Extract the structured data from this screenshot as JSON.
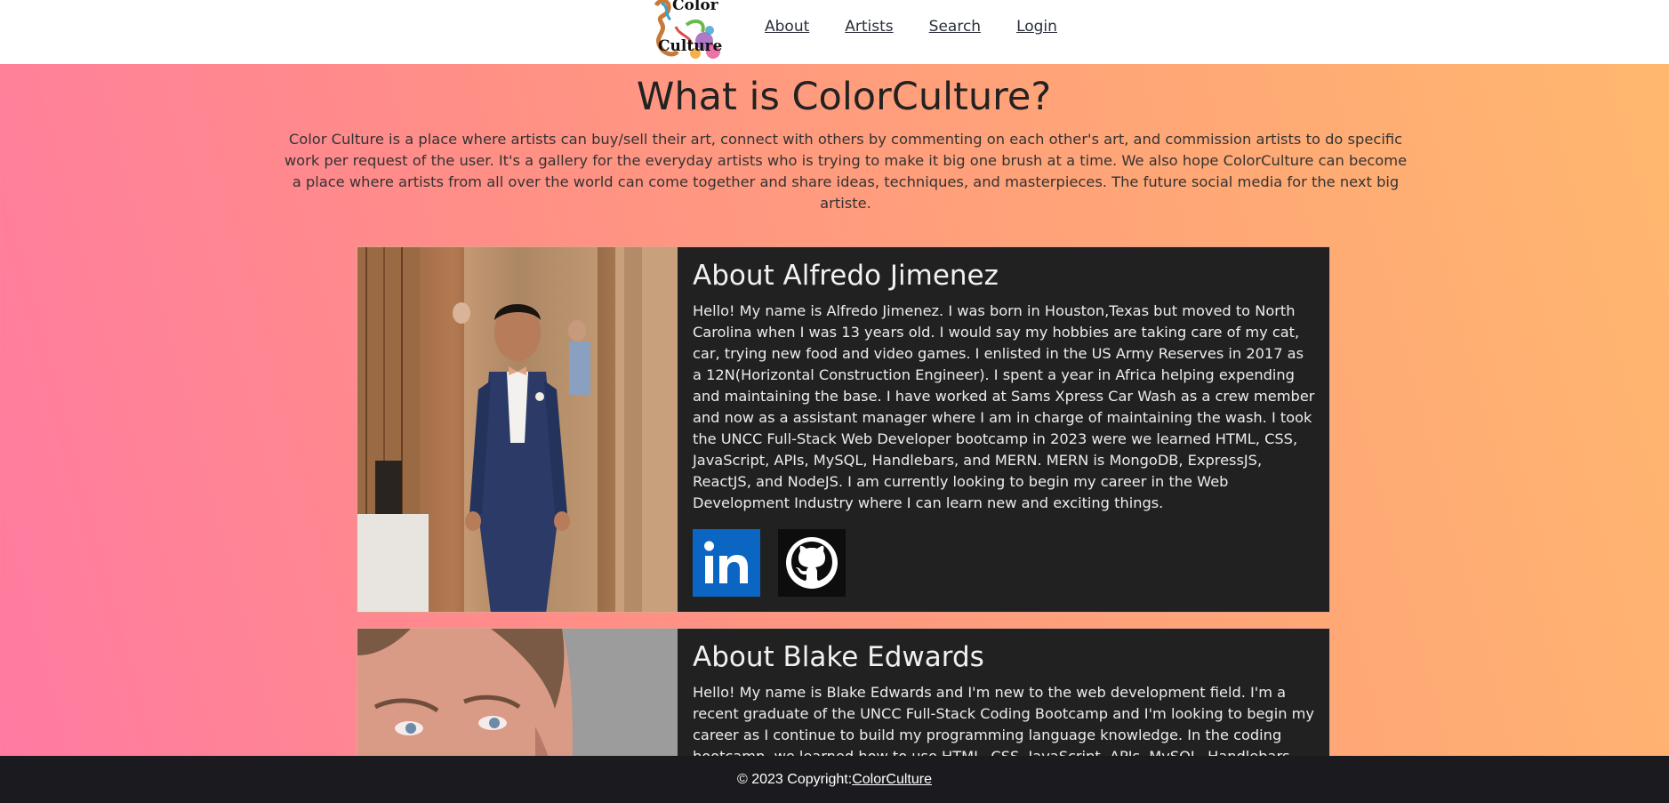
{
  "nav": {
    "logo_line1": "Color",
    "logo_line2": "Culture",
    "links": [
      "About",
      "Artists",
      "Search",
      "Login"
    ]
  },
  "hero": {
    "title": "What is ColorCulture?",
    "description": "Color Culture is a place where artists can buy/sell their art, connect with others by commenting on each other's art, and commission artists to do specific work per request of the user. It's a gallery for the everyday artists who is trying to make it big one brush at a time. We also hope ColorCulture can become a place where artists from all over the world can come together and share ideas, techniques, and masterpieces. The future social media for the next big artiste."
  },
  "members": [
    {
      "title": "About Alfredo Jimenez",
      "bio": "Hello! My name is Alfredo Jimenez. I was born in Houston,Texas but moved to North Carolina when I was 13 years old. I would say my hobbies are taking care of my cat, car, trying new food and video games. I enlisted in the US Army Reserves in 2017 as a 12N(Horizontal Construction Engineer). I spent a year in Africa helping expending and maintaining the base. I have worked at Sams Xpress Car Wash as a crew member and now as a assistant manager where I am in charge of maintaining the wash. I took the UNCC Full-Stack Web Developer bootcamp in 2023 were we learned HTML, CSS, JavaScript, APIs, MySQL, Handlebars, and MERN. MERN is MongoDB, ExpressJS, ReactJS, and NodeJS. I am currently looking to begin my career in the Web Development Industry where I can learn new and exciting things.",
      "linkedin_icon": "linkedin-icon",
      "github_icon": "github-icon"
    },
    {
      "title": "About Blake Edwards",
      "bio": "Hello! My name is Blake Edwards and I'm new to the web development field. I'm a recent graduate of the UNCC Full-Stack Coding Bootcamp and I'm looking to begin my career as I continue to build my programming language knowledge. In the coding bootcamp, we learned how to use HTML, CSS, JavaScript, APIs, MySQL, Handlebars, Express, Node.JS"
    }
  ],
  "footer": {
    "prefix": "© 2023 Copyright:",
    "link": "ColorCulture"
  },
  "colors": {
    "card_bg": "#212121",
    "footer_bg": "#1b1b1f",
    "linkedin_blue": "#0a66c2",
    "gradient_left": "#ff7aa2",
    "gradient_right": "#ffb86e"
  }
}
